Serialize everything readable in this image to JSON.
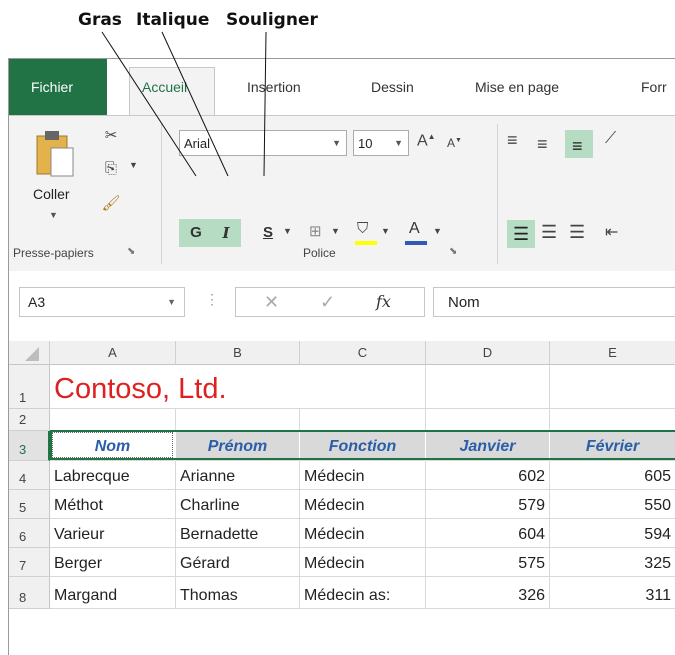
{
  "callouts": {
    "bold": "Gras",
    "italic": "Italique",
    "underline": "Souligner"
  },
  "tabs": {
    "file": "Fichier",
    "home": "Accueil",
    "insert": "Insertion",
    "draw": "Dessin",
    "layout": "Mise en page",
    "formulas": "Forr"
  },
  "ribbon": {
    "paste_label": "Coller",
    "clipboard_group": "Presse-papiers",
    "font_group": "Police",
    "font_name": "Arial",
    "font_size": "10",
    "bold_label": "G",
    "italic_label": "I",
    "underline_label": "S"
  },
  "formula_bar": {
    "name_box": "A3",
    "fx_label": "fx",
    "content": "Nom"
  },
  "colors": {
    "accent": "#217346",
    "selection_fill": "#b6dcc4",
    "title_red": "#e02020",
    "header_fill": "#d9d9d9",
    "header_text": "#2a5ea8"
  },
  "columns": [
    "A",
    "B",
    "C",
    "D",
    "E"
  ],
  "rows": [
    "1",
    "2",
    "3",
    "4",
    "5",
    "6",
    "7",
    "8"
  ],
  "sheet": {
    "title": "Contoso, Ltd.",
    "headers": [
      "Nom",
      "Prénom",
      "Fonction",
      "Janvier",
      "Février"
    ],
    "data": [
      [
        "Labrecque",
        "Arianne",
        "Médecin",
        "602",
        "605"
      ],
      [
        "Méthot",
        "Charline",
        "Médecin",
        "579",
        "550"
      ],
      [
        "Varieur",
        "Bernadette",
        "Médecin",
        "604",
        "594"
      ],
      [
        "Berger",
        "Gérard",
        "Médecin",
        "575",
        "325"
      ],
      [
        "Margand",
        "Thomas",
        "Médecin as:",
        "326",
        "311"
      ]
    ]
  }
}
